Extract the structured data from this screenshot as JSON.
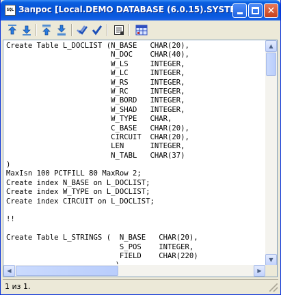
{
  "window": {
    "title": "Запрос [Local.DEMO DATABASE (6.0.15).SYSTE...",
    "icon_text": "SQL",
    "buttons": [
      "minimize",
      "maximize",
      "close"
    ]
  },
  "toolbar": {
    "tools": [
      {
        "name": "move-up-icon",
        "color": "#1e6fd0"
      },
      {
        "name": "move-down-icon",
        "color": "#1e6fd0"
      },
      {
        "name": "move-top-icon",
        "color": "#1e6fd0"
      },
      {
        "name": "move-bottom-icon",
        "color": "#1e6fd0"
      },
      {
        "name": "check-all-icon",
        "color": "#1c4fb8"
      },
      {
        "name": "check-icon",
        "color": "#1c4fb8"
      },
      {
        "name": "document-list-icon",
        "color": "#333333"
      },
      {
        "name": "database-grid-icon",
        "color": "#3050c0"
      }
    ]
  },
  "editor": {
    "lines": [
      "Create Table L_DOCLIST (N_BASE   CHAR(20),",
      "                        N_DOC    CHAR(40),",
      "                        W_LS     INTEGER,",
      "                        W_LC     INTEGER,",
      "                        W_RS     INTEGER,",
      "                        W_RC     INTEGER,",
      "                        W_BORD   INTEGER,",
      "                        W_SHAD   INTEGER,",
      "                        W_TYPE   CHAR,",
      "                        C_BASE   CHAR(20),",
      "                        CIRCUIT  CHAR(20),",
      "                        LEN      INTEGER,",
      "                        N_TABL   CHAR(37)",
      ")",
      "MaxIsn 100 PCTFILL 80 MaxRow 2;",
      "Create index N_BASE on L_DOCLIST;",
      "Create index W_TYPE on L_DOCLIST;",
      "Create index CIRCUIT on L_DOCLIST;",
      "",
      "!!",
      "",
      "Create Table L_STRINGS (  N_BASE   CHAR(20),",
      "                          S_POS    INTEGER,",
      "                          FIELD    CHAR(220)",
      "                         )"
    ]
  },
  "status": {
    "text": "1 из 1."
  }
}
